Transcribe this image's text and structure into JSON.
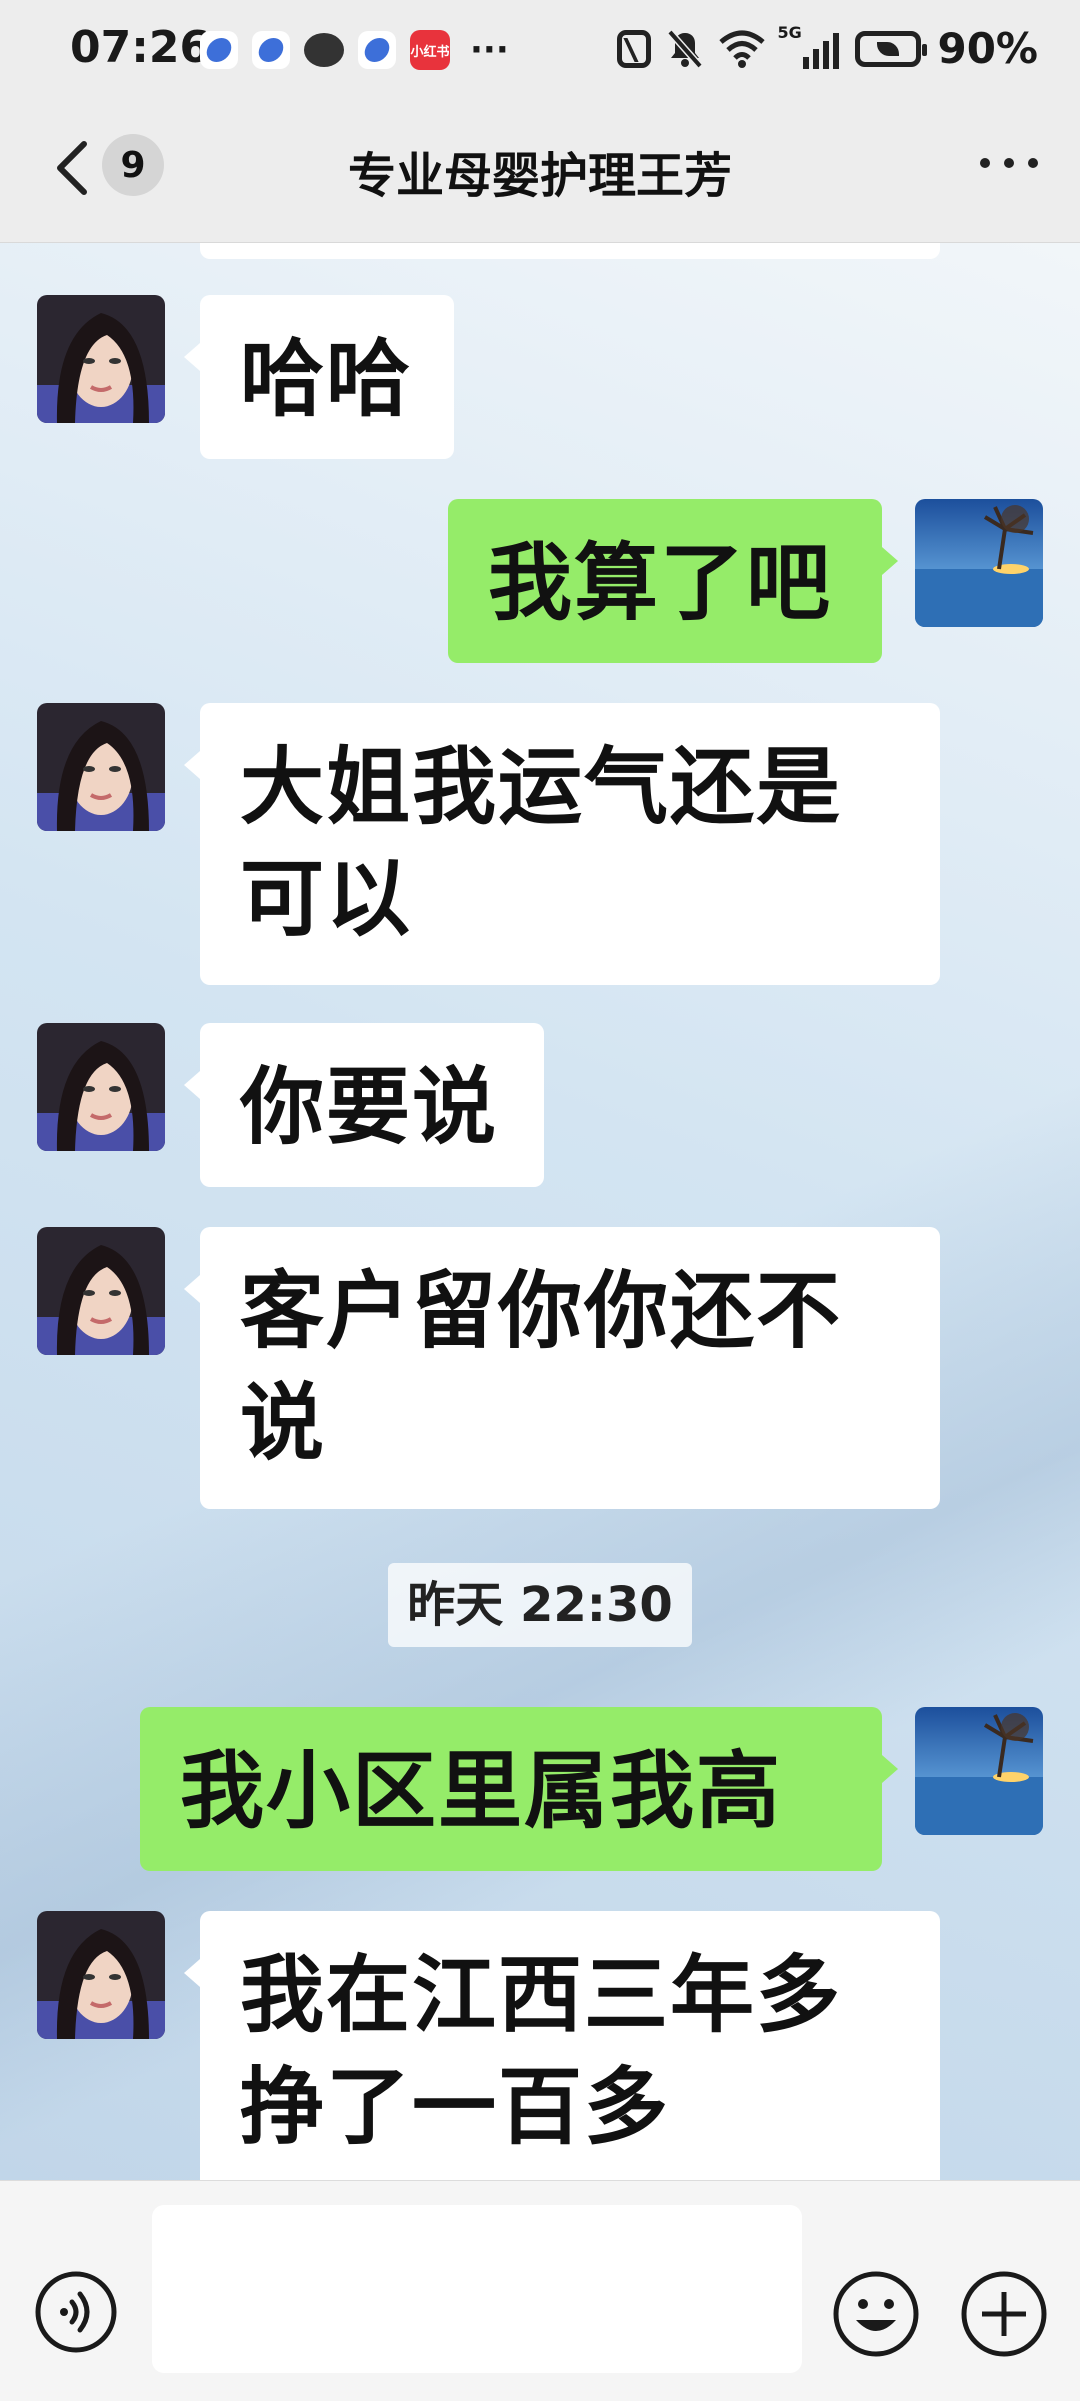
{
  "status_bar": {
    "time": "07:26",
    "notification_app_label": "小红书",
    "signal_label": "5G",
    "battery_percent": "90%"
  },
  "nav": {
    "unread_count": "9",
    "title": "专业母婴护理王芳"
  },
  "messages": [
    {
      "from": "them",
      "text": "哈哈"
    },
    {
      "from": "me",
      "text": "我算了吧"
    },
    {
      "from": "them",
      "lines": [
        "大姐我运气还是",
        "可以"
      ]
    },
    {
      "from": "them",
      "text": "你要说"
    },
    {
      "from": "them",
      "lines": [
        "客户留你你还不",
        "说"
      ]
    },
    {
      "type": "timestamp",
      "text": "昨天 22:30"
    },
    {
      "from": "me",
      "text": "我小区里属我高"
    },
    {
      "from": "them",
      "lines": [
        "我在江西三年多",
        "挣了一百多"
      ]
    }
  ],
  "input": {
    "placeholder": ""
  },
  "colors": {
    "outgoing_bubble": "#95ec69",
    "incoming_bubble": "#ffffff",
    "bar_background": "#ededed"
  },
  "icons": [
    "back-icon",
    "more-icon",
    "voice-icon",
    "emoji-icon",
    "plus-icon"
  ]
}
